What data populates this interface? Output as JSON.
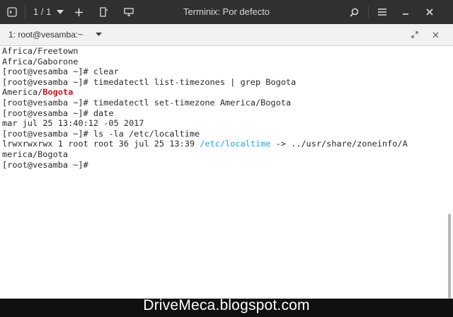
{
  "titlebar": {
    "title": "Terminix: Por defecto",
    "session_counter": "1 / 1",
    "icons": [
      "terminix-app-icon",
      "chevron-down-icon",
      "add-icon",
      "new-terminal-icon",
      "screen-icon",
      "search-icon",
      "hamburger-menu-icon",
      "minimize-icon",
      "close-icon"
    ]
  },
  "tab": {
    "label": "1: root@vesamba:~",
    "icons": [
      "dropdown-arrow-icon",
      "maximize-icon",
      "close-icon"
    ]
  },
  "terminal": {
    "lines": [
      [
        {
          "t": "Africa/Freetown"
        }
      ],
      [
        {
          "t": "Africa/Gaborone"
        }
      ],
      [
        {
          "t": "[root@vesamba ~]# clear"
        }
      ],
      [
        {
          "t": "[root@vesamba ~]# timedatectl list-timezones | grep Bogota"
        }
      ],
      [
        {
          "t": "America/"
        },
        {
          "t": "Bogota",
          "c": "red"
        }
      ],
      [
        {
          "t": "[root@vesamba ~]# timedatectl set-timezone America/Bogota"
        }
      ],
      [
        {
          "t": "[root@vesamba ~]# date"
        }
      ],
      [
        {
          "t": "mar jul 25 13:40:12 -05 2017"
        }
      ],
      [
        {
          "t": "[root@vesamba ~]# ls -la /etc/localtime"
        }
      ],
      [
        {
          "t": "lrwxrwxrwx 1 root root 36 jul 25 13:39 "
        },
        {
          "t": "/etc/localtime",
          "c": "cyan"
        },
        {
          "t": " -> ../usr/share/zoneinfo/A"
        }
      ],
      [
        {
          "t": "merica/Bogota"
        }
      ],
      [
        {
          "t": "[root@vesamba ~]#"
        }
      ]
    ]
  },
  "watermark": "DriveMeca.blogspot.com",
  "colors": {
    "titlebar_bg": "#2f3032",
    "tabbar_bg": "#f2f1f0",
    "highlight_red": "#cc1a1a",
    "highlight_cyan": "#1aa6e0"
  }
}
